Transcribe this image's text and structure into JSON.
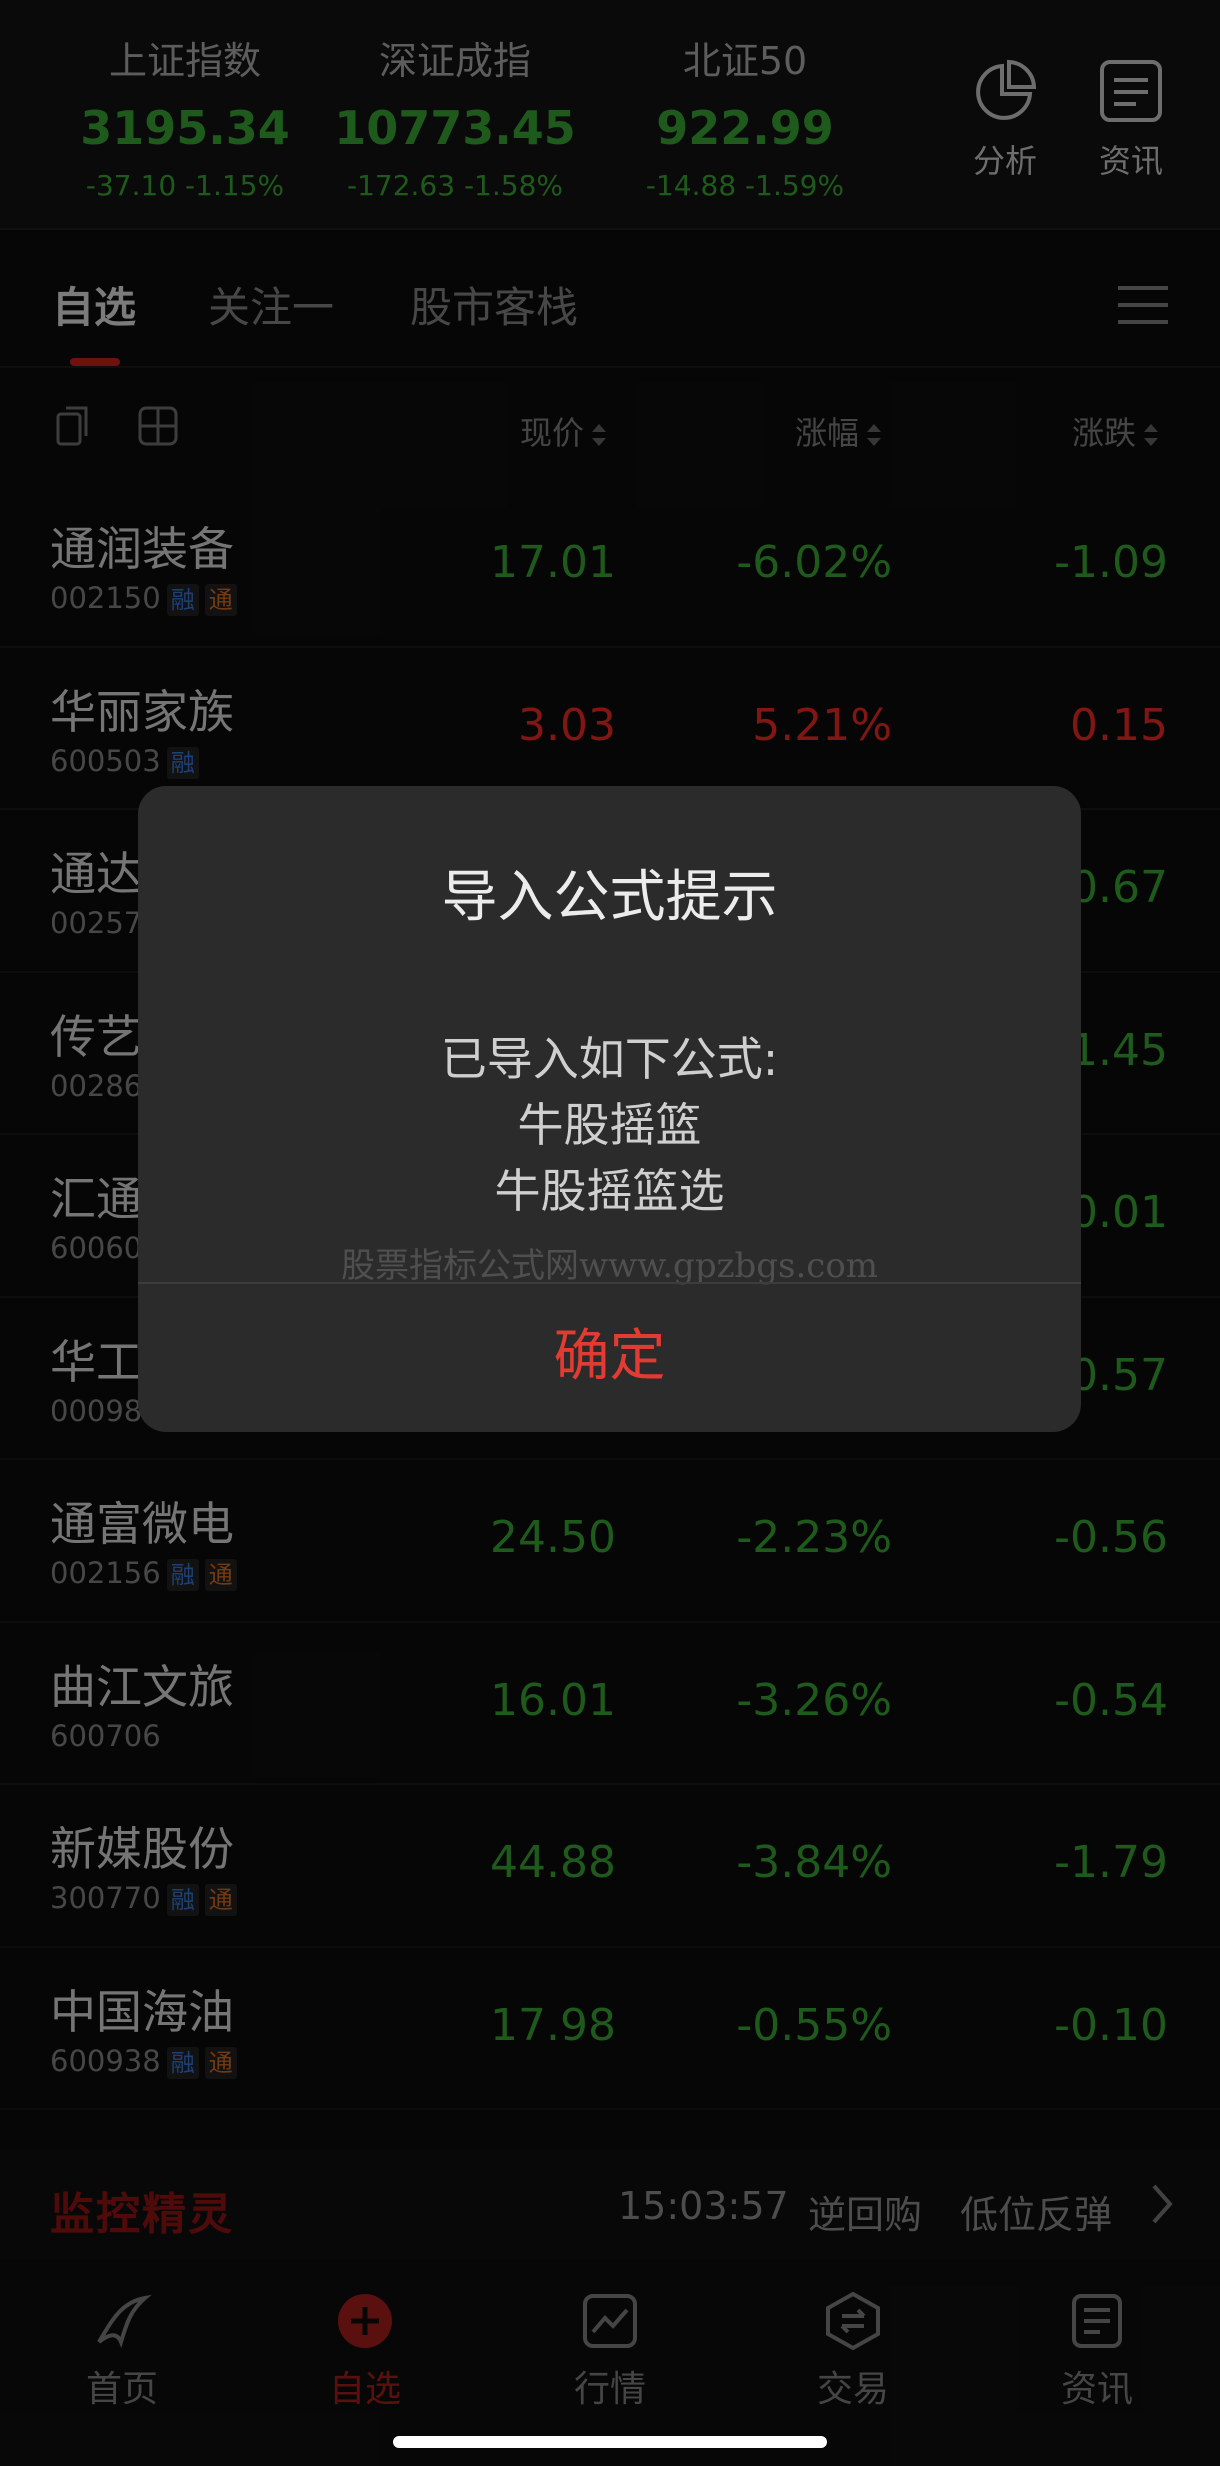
{
  "indices": [
    {
      "name": "上证指数",
      "value": "3195.34",
      "change": "-37.10",
      "pct": "-1.15%"
    },
    {
      "name": "深证成指",
      "value": "10773.45",
      "change": "-172.63",
      "pct": "-1.58%"
    },
    {
      "name": "北证50",
      "value": "922.99",
      "change": "-14.88",
      "pct": "-1.59%"
    }
  ],
  "header_buttons": {
    "analysis": "分析",
    "news": "资讯"
  },
  "tabs": [
    "自选",
    "关注一",
    "股市客栈"
  ],
  "columns": {
    "price": "现价",
    "pct": "涨幅",
    "change": "涨跌"
  },
  "stocks": [
    {
      "name": "通润装备",
      "code": "002150",
      "badges": [
        "融",
        "通"
      ],
      "price": "17.01",
      "pct": "-6.02%",
      "change": "-1.09",
      "trend": "down"
    },
    {
      "name": "华丽家族",
      "code": "600503",
      "badges": [
        "融"
      ],
      "price": "3.03",
      "pct": "5.21%",
      "change": "0.15",
      "trend": "up"
    },
    {
      "name": "通达",
      "code": "00257",
      "badges": [],
      "price": "",
      "pct": "",
      "change": "0.67",
      "trend": "down"
    },
    {
      "name": "传艺",
      "code": "00286",
      "badges": [],
      "price": "",
      "pct": "",
      "change": "1.45",
      "trend": "down"
    },
    {
      "name": "汇通",
      "code": "60060",
      "badges": [],
      "price": "",
      "pct": "",
      "change": "0.01",
      "trend": "down"
    },
    {
      "name": "华工",
      "code": "00098",
      "badges": [],
      "price": "",
      "pct": "",
      "change": "0.57",
      "trend": "down"
    },
    {
      "name": "通富微电",
      "code": "002156",
      "badges": [
        "融",
        "通"
      ],
      "price": "24.50",
      "pct": "-2.23%",
      "change": "-0.56",
      "trend": "down"
    },
    {
      "name": "曲江文旅",
      "code": "600706",
      "badges": [],
      "price": "16.01",
      "pct": "-3.26%",
      "change": "-0.54",
      "trend": "down"
    },
    {
      "name": "新媒股份",
      "code": "300770",
      "badges": [
        "融",
        "通"
      ],
      "price": "44.88",
      "pct": "-3.84%",
      "change": "-1.79",
      "trend": "down"
    },
    {
      "name": "中国海油",
      "code": "600938",
      "badges": [
        "融",
        "通"
      ],
      "price": "17.98",
      "pct": "-0.55%",
      "change": "-0.10",
      "trend": "down"
    }
  ],
  "ticker": {
    "logo": "监控精灵",
    "time": "15:03:57",
    "event1": "逆回购",
    "event2": "低位反弹"
  },
  "bottom_nav": [
    "首页",
    "自选",
    "行情",
    "交易",
    "资讯"
  ],
  "dialog": {
    "title": "导入公式提示",
    "message_line1": "已导入如下公式:",
    "message_line2": "牛股摇篮",
    "message_line3": "牛股摇篮选",
    "watermark": "股票指标公式网www.gpzbgs.com",
    "confirm": "确定"
  },
  "colors": {
    "down": "#2f8a2a",
    "up": "#c8231e",
    "accent": "#e23b33"
  }
}
